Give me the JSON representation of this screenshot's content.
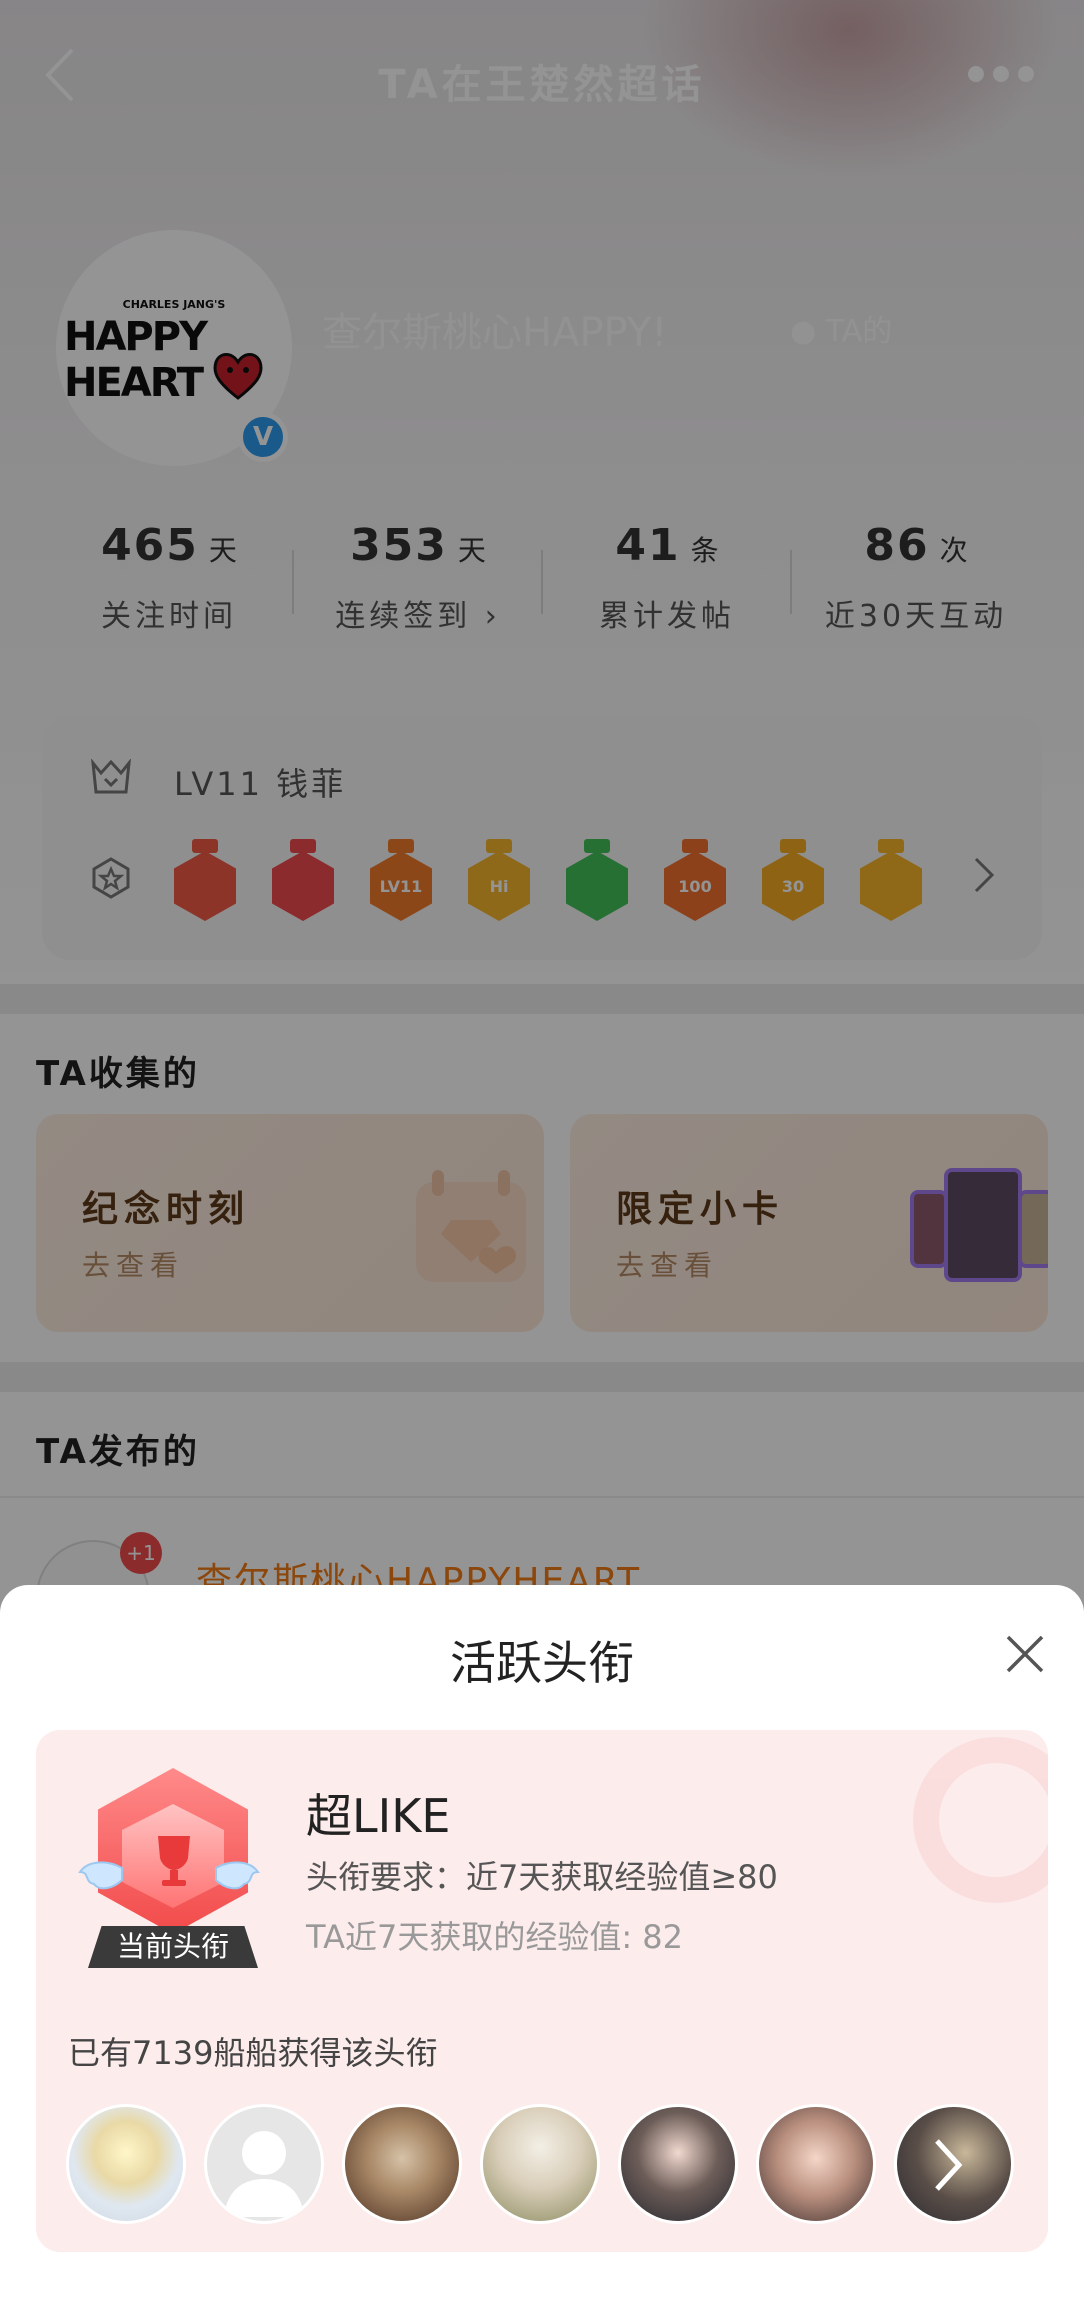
{
  "nav": {
    "title": "TA在王楚然超话"
  },
  "profile": {
    "avatar_small_text": "CHARLES JANG'S",
    "avatar_big_text": "HAPPY HEART",
    "verified_mark": "V",
    "name": "查尔斯桃心HAPPY!",
    "ta_badge": "TA的"
  },
  "stats": [
    {
      "num": "465",
      "unit": "天",
      "label": "关注时间"
    },
    {
      "num": "353",
      "unit": "天",
      "label": "连续签到 ›"
    },
    {
      "num": "41",
      "unit": "条",
      "label": "累计发帖"
    },
    {
      "num": "86",
      "unit": "次",
      "label": "近30天互动"
    }
  ],
  "level": {
    "text": "LV11 钱菲"
  },
  "badges": [
    {
      "icon": "fox-badge",
      "color": "#ef5a44",
      "label": ""
    },
    {
      "icon": "trophy-badge",
      "color": "#f04a4f",
      "label": ""
    },
    {
      "icon": "lv11-badge",
      "color": "#f27a2c",
      "label": "LV11"
    },
    {
      "icon": "hi-badge",
      "color": "#f5b52e",
      "label": "Hi"
    },
    {
      "icon": "hand-badge",
      "color": "#42c25a",
      "label": ""
    },
    {
      "icon": "100days-badge",
      "color": "#f2702f",
      "label": "100"
    },
    {
      "icon": "30days-badge",
      "color": "#f5ad24",
      "label": "30"
    },
    {
      "icon": "emoji-badge",
      "color": "#f6b52a",
      "label": ""
    }
  ],
  "collected": {
    "title": "TA收集的",
    "items": [
      {
        "title": "纪念时刻",
        "sub": "去查看"
      },
      {
        "title": "限定小卡",
        "sub": "去查看"
      }
    ]
  },
  "posted": {
    "title": "TA发布的",
    "author": "查尔斯桃心HAPPYHEART",
    "plus": "+1"
  },
  "sheet": {
    "title": "活跃头衔",
    "card": {
      "tag": "当前头衔",
      "name": "超LIKE",
      "requirement": "头衔要求：近7天获取经验值≥80",
      "exp": "TA近7天获取的经验值: 82",
      "owners": "已有7139船船获得该头衔"
    },
    "avatars": [
      "user-avatar-1",
      "user-avatar-2",
      "user-avatar-3",
      "user-avatar-4",
      "user-avatar-5",
      "user-avatar-6",
      "user-avatar-7"
    ]
  }
}
